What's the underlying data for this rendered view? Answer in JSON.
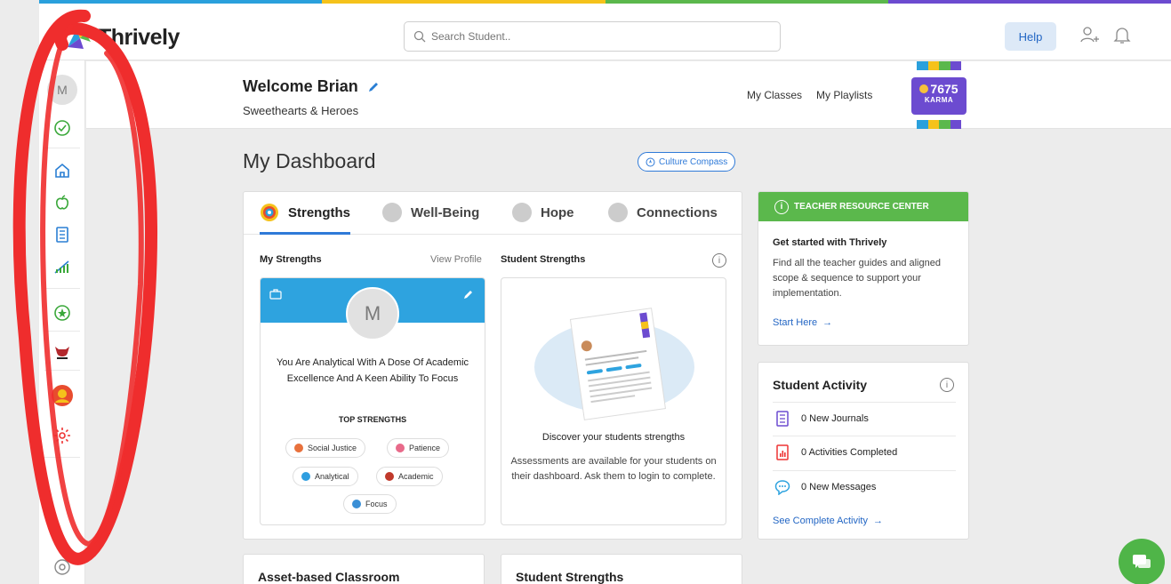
{
  "app": {
    "name": "Thrively"
  },
  "colors": {
    "stripe": [
      "#2aa0dc",
      "#f5c21b",
      "#5bb84c",
      "#6c4bd0"
    ],
    "accent": "#2f7ad8",
    "brand_green": "#5bb84c",
    "karma_purple": "#6c4bd0"
  },
  "search": {
    "placeholder": "Search Student.."
  },
  "header": {
    "help": "Help"
  },
  "sidebar": {
    "avatar_letter": "M",
    "items": [
      {
        "icon": "check-circle-icon"
      },
      {
        "icon": "home-icon"
      },
      {
        "icon": "apple-icon"
      },
      {
        "icon": "journal-icon"
      },
      {
        "icon": "chart-icon"
      },
      {
        "icon": "star-badge-icon"
      },
      {
        "icon": "heroes-logo-icon"
      },
      {
        "icon": "avatar-icon"
      },
      {
        "icon": "gear-icon"
      },
      {
        "icon": "collapse-icon"
      }
    ]
  },
  "welcome": {
    "title": "Welcome Brian",
    "subtitle": "Sweethearts & Heroes",
    "links": [
      "My Classes",
      "My Playlists"
    ],
    "karma_value": "7675",
    "karma_label": "KARMA"
  },
  "dashboard": {
    "title": "My Dashboard",
    "culture_compass": "Culture Compass",
    "tabs": [
      "Strengths",
      "Well-Being",
      "Hope",
      "Connections"
    ],
    "active_tab": "Strengths",
    "my_strengths": "My Strengths",
    "view_profile": "View Profile",
    "student_strengths": "Student Strengths",
    "profile_letter": "M",
    "profile_description": "You Are Analytical With A Dose Of Academic Excellence And A Keen Ability To Focus",
    "top_strengths_label": "TOP STRENGTHS",
    "chips": [
      {
        "label": "Social Justice",
        "color": "#e8713c"
      },
      {
        "label": "Patience",
        "color": "#e86a8a"
      },
      {
        "label": "Analytical",
        "color": "#2f9ee0"
      },
      {
        "label": "Academic",
        "color": "#c0392b"
      },
      {
        "label": "Focus",
        "color": "#3a8fd6"
      }
    ],
    "discover": "Discover your students strengths",
    "assess": "Assessments are available for your students on their dashboard. Ask them to login to complete."
  },
  "resource": {
    "header": "TEACHER RESOURCE CENTER",
    "title": "Get started with Thrively",
    "desc": "Find all the teacher guides and aligned scope & sequence to support your implementation.",
    "link": "Start Here"
  },
  "activity": {
    "title": "Student Activity",
    "rows": [
      "0 New Journals",
      "0 Activities Completed",
      "0 New Messages"
    ],
    "link": "See Complete Activity"
  },
  "bottom": [
    "Asset-based Classroom",
    "Student Strengths"
  ]
}
